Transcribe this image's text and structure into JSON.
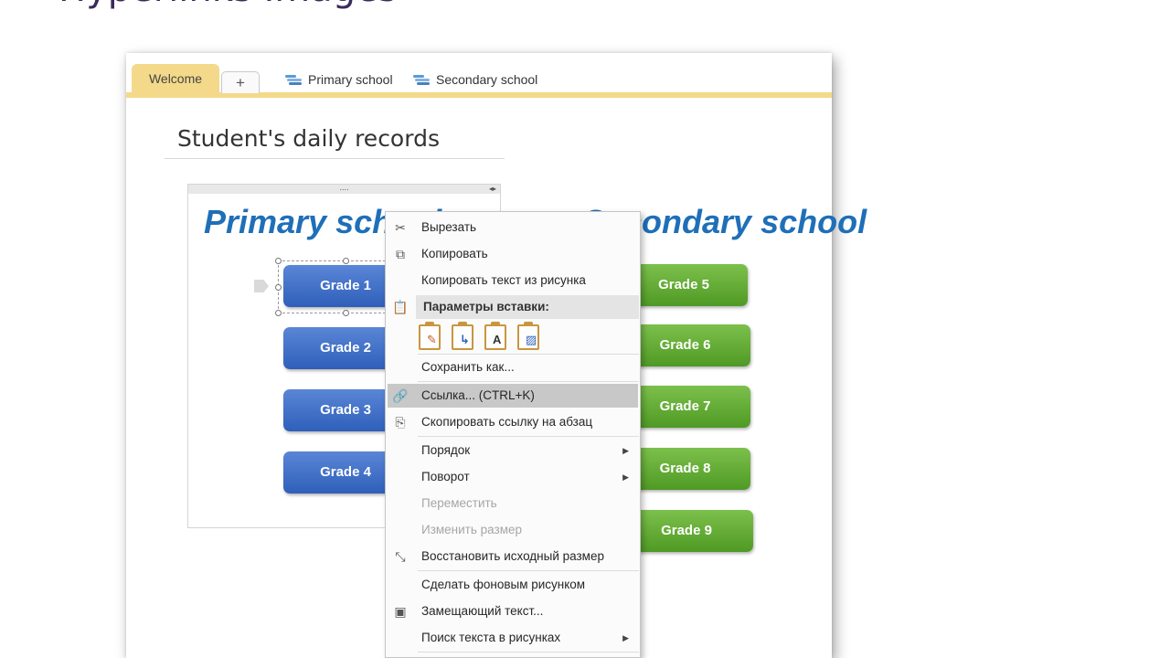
{
  "slide": {
    "title": "Hyperlinks Images"
  },
  "tabs": {
    "welcome": "Welcome",
    "add": "+",
    "sections": [
      {
        "label": "Primary school"
      },
      {
        "label": "Secondary school"
      }
    ]
  },
  "page": {
    "title": "Student's daily records"
  },
  "container": {
    "handle": "....",
    "arrows": "◂▸"
  },
  "headings": {
    "primary": "Primary school",
    "secondary": "Secondary school"
  },
  "grades": {
    "blue": [
      "Grade 1",
      "Grade 2",
      "Grade 3",
      "Grade 4"
    ],
    "green": [
      "Grade 5",
      "Grade 6",
      "Grade 7",
      "Grade 8",
      "Grade 9"
    ]
  },
  "context_menu": {
    "cut": "Вырезать",
    "copy": "Копировать",
    "copy_text": "Копировать текст из рисунка",
    "paste_header": "Параметры вставки:",
    "save_as": "Сохранить как...",
    "link": "Ссылка...  (CTRL+K)",
    "copy_link": "Скопировать ссылку на абзац",
    "order": "Порядок",
    "rotate": "Поворот",
    "move": "Переместить",
    "resize": "Изменить размер",
    "restore": "Восстановить исходный размер",
    "set_background": "Сделать фоновым рисунком",
    "alt_text": "Замещающий текст...",
    "search_text": "Поиск текста в рисунках"
  },
  "colors": {
    "accent_tab": "#f4d98a",
    "heading_blue": "#1f6fb8",
    "button_blue": "#2f5fba",
    "button_green": "#4f9a24",
    "menu_highlight": "#c8c8c8"
  }
}
